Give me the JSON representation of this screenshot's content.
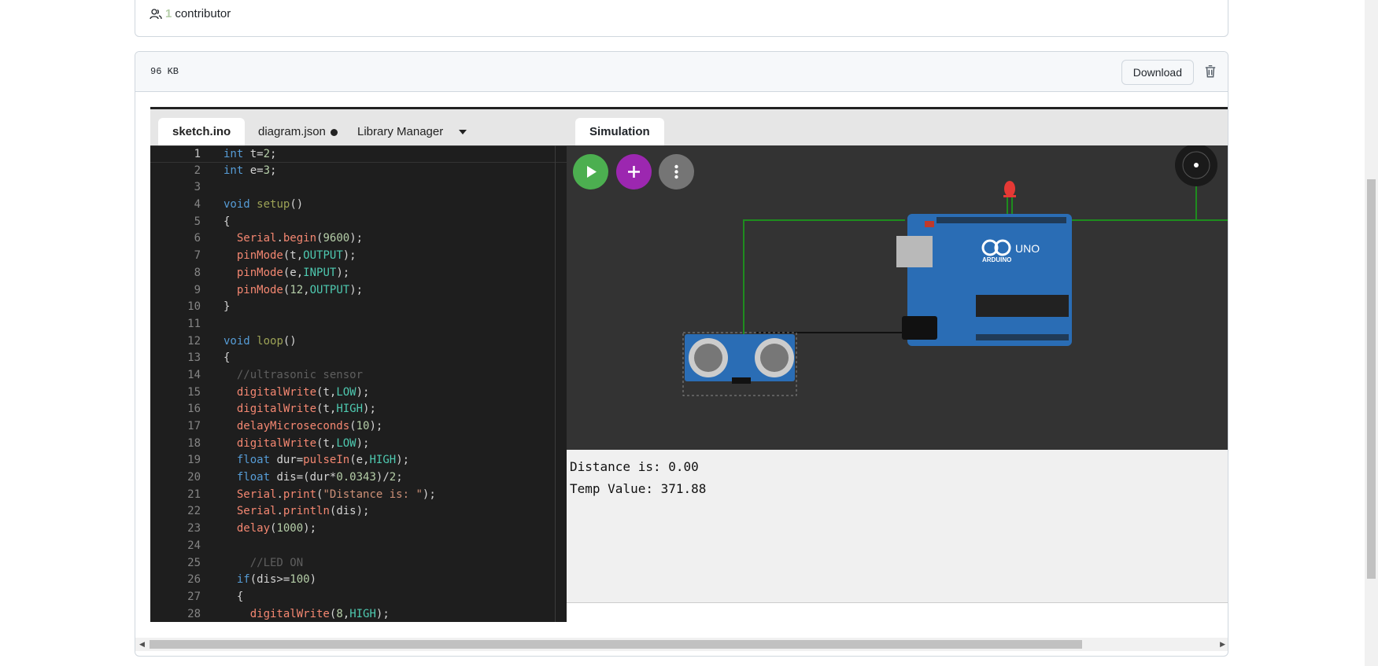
{
  "contributors": {
    "count": "1",
    "label": "contributor"
  },
  "file": {
    "size": "96 KB",
    "download_label": "Download"
  },
  "editor": {
    "tabs": [
      {
        "label": "sketch.ino"
      },
      {
        "label": "diagram.json"
      },
      {
        "label": "Library Manager"
      }
    ],
    "lines": [
      {
        "n": "1",
        "html": "<span class='kw'>int</span> t=<span class='num'>2</span>;"
      },
      {
        "n": "2",
        "html": "<span class='kw'>int</span> e=<span class='num'>3</span>;"
      },
      {
        "n": "3",
        "html": ""
      },
      {
        "n": "4",
        "html": "<span class='kw'>void</span> <span class='fnu'>setup</span>()"
      },
      {
        "n": "5",
        "html": "{"
      },
      {
        "n": "6",
        "html": "  <span class='fn'>Serial</span>.<span class='fn'>begin</span>(<span class='num'>9600</span>);"
      },
      {
        "n": "7",
        "html": "  <span class='fn'>pinMode</span>(t,<span class='const'>OUTPUT</span>);"
      },
      {
        "n": "8",
        "html": "  <span class='fn'>pinMode</span>(e,<span class='const'>INPUT</span>);"
      },
      {
        "n": "9",
        "html": "  <span class='fn'>pinMode</span>(<span class='num'>12</span>,<span class='const'>OUTPUT</span>);"
      },
      {
        "n": "10",
        "html": "}"
      },
      {
        "n": "11",
        "html": ""
      },
      {
        "n": "12",
        "html": "<span class='kw'>void</span> <span class='fnu'>loop</span>()"
      },
      {
        "n": "13",
        "html": "{"
      },
      {
        "n": "14",
        "html": "  <span class='cmt'>//ultrasonic sensor</span>"
      },
      {
        "n": "15",
        "html": "  <span class='fn'>digitalWrite</span>(t,<span class='const'>LOW</span>);"
      },
      {
        "n": "16",
        "html": "  <span class='fn'>digitalWrite</span>(t,<span class='const'>HIGH</span>);"
      },
      {
        "n": "17",
        "html": "  <span class='fn'>delayMicroseconds</span>(<span class='num'>10</span>);"
      },
      {
        "n": "18",
        "html": "  <span class='fn'>digitalWrite</span>(t,<span class='const'>LOW</span>);"
      },
      {
        "n": "19",
        "html": "  <span class='kw'>float</span> dur=<span class='fn'>pulseIn</span>(e,<span class='const'>HIGH</span>);"
      },
      {
        "n": "20",
        "html": "  <span class='kw'>float</span> dis=(dur*<span class='num'>0.0343</span>)/<span class='num'>2</span>;"
      },
      {
        "n": "21",
        "html": "  <span class='fn'>Serial</span>.<span class='fn'>print</span>(<span class='str'>\"Distance is: \"</span>);"
      },
      {
        "n": "22",
        "html": "  <span class='fn'>Serial</span>.<span class='fn'>println</span>(dis);"
      },
      {
        "n": "23",
        "html": "  <span class='fn'>delay</span>(<span class='num'>1000</span>);"
      },
      {
        "n": "24",
        "html": ""
      },
      {
        "n": "25",
        "html": "    <span class='cmt'>//LED ON</span>"
      },
      {
        "n": "26",
        "html": "  <span class='kw'>if</span>(dis>=<span class='num'>100</span>)"
      },
      {
        "n": "27",
        "html": "  {"
      },
      {
        "n": "28",
        "html": "    <span class='fn'>digitalWrite</span>(<span class='num'>8</span>,<span class='const'>HIGH</span>);"
      }
    ]
  },
  "simulation": {
    "tab_label": "Simulation",
    "board_label": "UNO",
    "board_brand": "ARDUINO",
    "serial_output": [
      "Distance is: 0.00",
      "Temp Value: 371.88"
    ]
  },
  "icons": {
    "contributors": "people-icon",
    "trash": "trash-icon",
    "play": "play-icon",
    "add": "plus-icon",
    "more": "kebab-menu-icon"
  },
  "colors": {
    "play": "#4caf50",
    "add": "#9c27b0",
    "more": "#757575",
    "board": "#2a6db5",
    "wire": "#1e8c1e"
  }
}
